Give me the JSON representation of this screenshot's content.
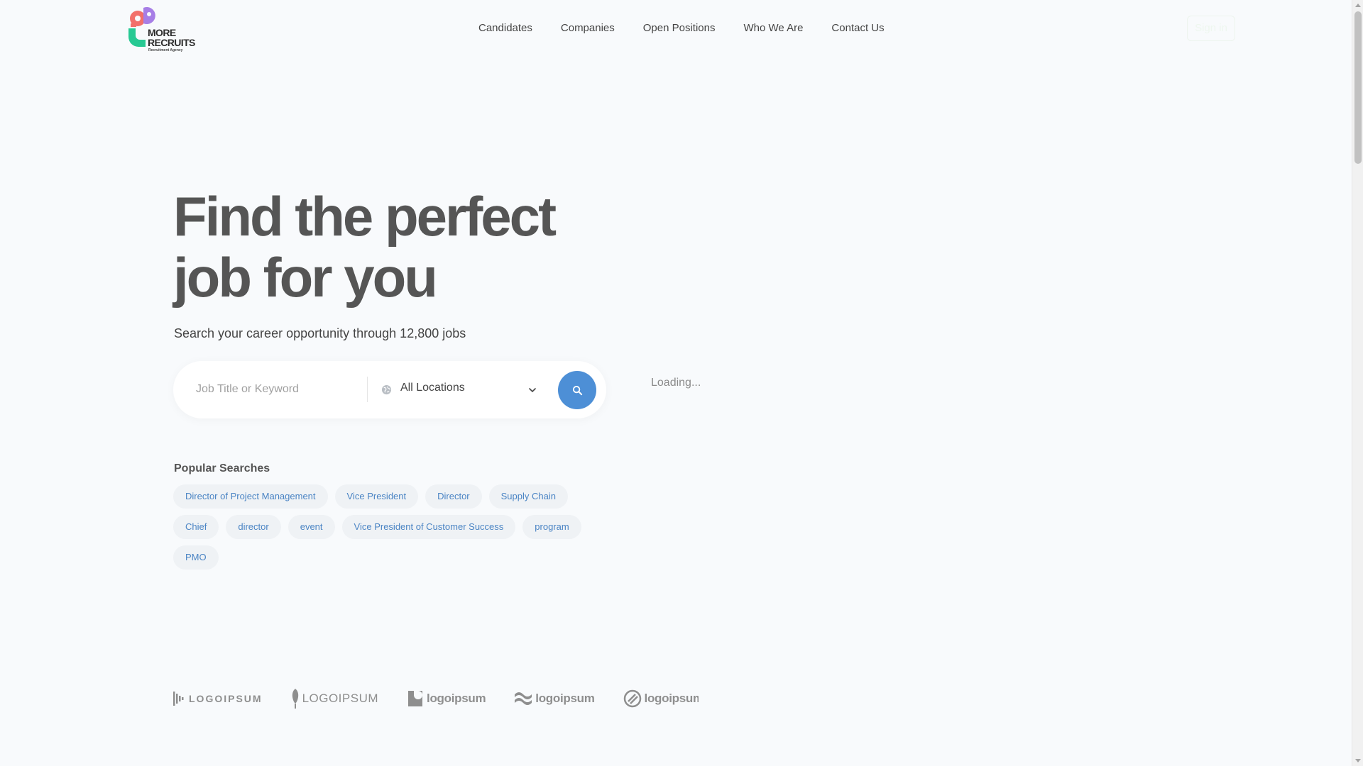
{
  "brand": {
    "logo_line1": "MORE",
    "logo_line2": "RECRUITS",
    "logo_sub": "Recruitment Agency",
    "colors": {
      "coral": "#f2706a",
      "purple": "#a77ee6",
      "green": "#27c993",
      "accent": "#4d8fd6"
    }
  },
  "nav": {
    "items": [
      {
        "label": "Candidates"
      },
      {
        "label": "Companies"
      },
      {
        "label": "Open Positions"
      },
      {
        "label": "Who We Are"
      },
      {
        "label": "Contact Us"
      }
    ],
    "signin_label": "Sign in"
  },
  "hero": {
    "title": "Find the perfect job for you",
    "subtitle": "Search your career opportunity through 12,800 jobs"
  },
  "search": {
    "keyword_placeholder": "Job Title or Keyword",
    "location_value": "All Locations",
    "icons": {
      "location": "globe-icon",
      "dropdown": "chevron-down-icon",
      "submit": "search-icon"
    }
  },
  "side_panel": {
    "loading_text": "Loading..."
  },
  "popular": {
    "title": "Popular Searches",
    "tags": [
      "Director of Project Management",
      "Vice President",
      "Director",
      "Supply Chain",
      "Chief",
      "director",
      "event",
      "Vice President of Customer Success",
      "program",
      "PMO"
    ]
  },
  "partners": {
    "logos": [
      {
        "text": "LOGOIPSUM",
        "icon": "bars-icon"
      },
      {
        "text": "LOGOIPSUM",
        "icon": "feather-icon"
      },
      {
        "text": "logoipsum",
        "icon": "square-swirl-icon"
      },
      {
        "text": "logoipsum",
        "icon": "waves-icon"
      },
      {
        "text": "logoipsum",
        "icon": "circle-slash-icon"
      }
    ]
  }
}
